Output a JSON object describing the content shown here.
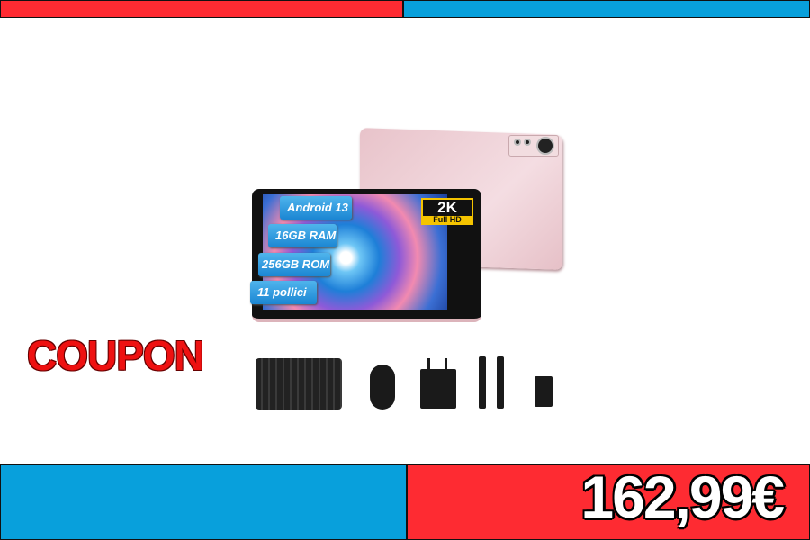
{
  "promo": {
    "coupon_label": "COUPON",
    "price": "162,99€"
  },
  "product": {
    "specs": [
      "Android 13",
      "16GB RAM",
      "256GB ROM",
      "11 pollici"
    ],
    "badge": {
      "main": "2K",
      "sub": "Full HD"
    },
    "accessories": [
      "keyboard",
      "mouse",
      "charger",
      "usb-cable",
      "otg-adapter"
    ]
  },
  "colors": {
    "red": "#fe2b32",
    "blue": "#08a0dc",
    "tablet": "#e8c3ca"
  }
}
